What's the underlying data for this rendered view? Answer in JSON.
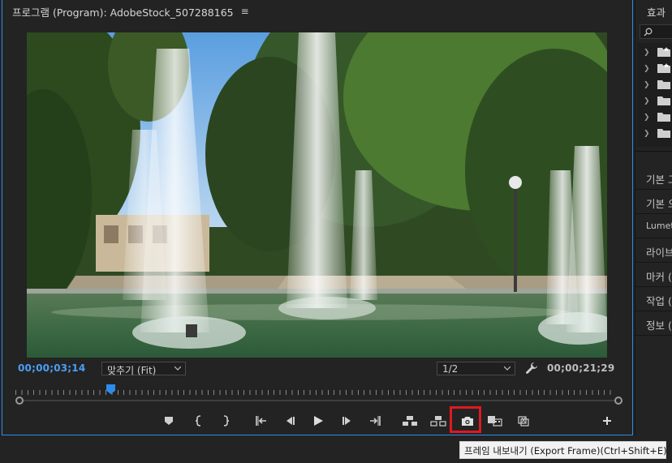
{
  "program_monitor": {
    "title": "프로그램 (Program): AdobeStock_507288165",
    "menu_icon": "hamburger-icon",
    "current_timecode": "00;00;03;14",
    "duration_timecode": "00;00;21;29",
    "zoom_select": "맞추기 (Fit)",
    "resolution_select": "1/2",
    "playhead_progress": 0.155,
    "controls": [
      {
        "name": "add-marker-button",
        "icon": "marker-icon"
      },
      {
        "name": "mark-in-button",
        "icon": "mark-in-icon"
      },
      {
        "name": "mark-out-button",
        "icon": "mark-out-icon"
      },
      {
        "name": "go-to-in-button",
        "icon": "go-to-in-icon"
      },
      {
        "name": "step-back-button",
        "icon": "step-back-icon"
      },
      {
        "name": "play-button",
        "icon": "play-icon"
      },
      {
        "name": "step-forward-button",
        "icon": "step-forward-icon"
      },
      {
        "name": "go-to-out-button",
        "icon": "go-to-out-icon"
      },
      {
        "name": "lift-button",
        "icon": "lift-icon"
      },
      {
        "name": "extract-button",
        "icon": "extract-icon"
      },
      {
        "name": "export-frame-button",
        "icon": "camera-icon"
      },
      {
        "name": "comparison-view-button",
        "icon": "comparison-view-icon"
      },
      {
        "name": "proxy-toggle-button",
        "icon": "proxy-icon"
      },
      {
        "name": "button-editor-button",
        "icon": "plus-icon"
      }
    ],
    "accent_color": "#2d8ceb",
    "highlight_color": "#e0191f"
  },
  "effects_panel": {
    "title": "효과",
    "search_icon": "search-icon",
    "folders": [
      {
        "icon": "preset-folder-icon"
      },
      {
        "icon": "preset-folder-icon"
      },
      {
        "icon": "folder-icon"
      },
      {
        "icon": "folder-icon"
      },
      {
        "icon": "folder-icon"
      },
      {
        "icon": "folder-icon"
      }
    ],
    "sections": [
      {
        "label": "기본 그"
      },
      {
        "label": "기본 오"
      },
      {
        "label": "Lumetri"
      },
      {
        "label": "라이브"
      },
      {
        "label": "마커 ("
      },
      {
        "label": "작업 ("
      },
      {
        "label": "정보 ("
      }
    ]
  },
  "tooltip": {
    "text": "프레임 내보내기 (Export Frame)(Ctrl+Shift+E)"
  }
}
